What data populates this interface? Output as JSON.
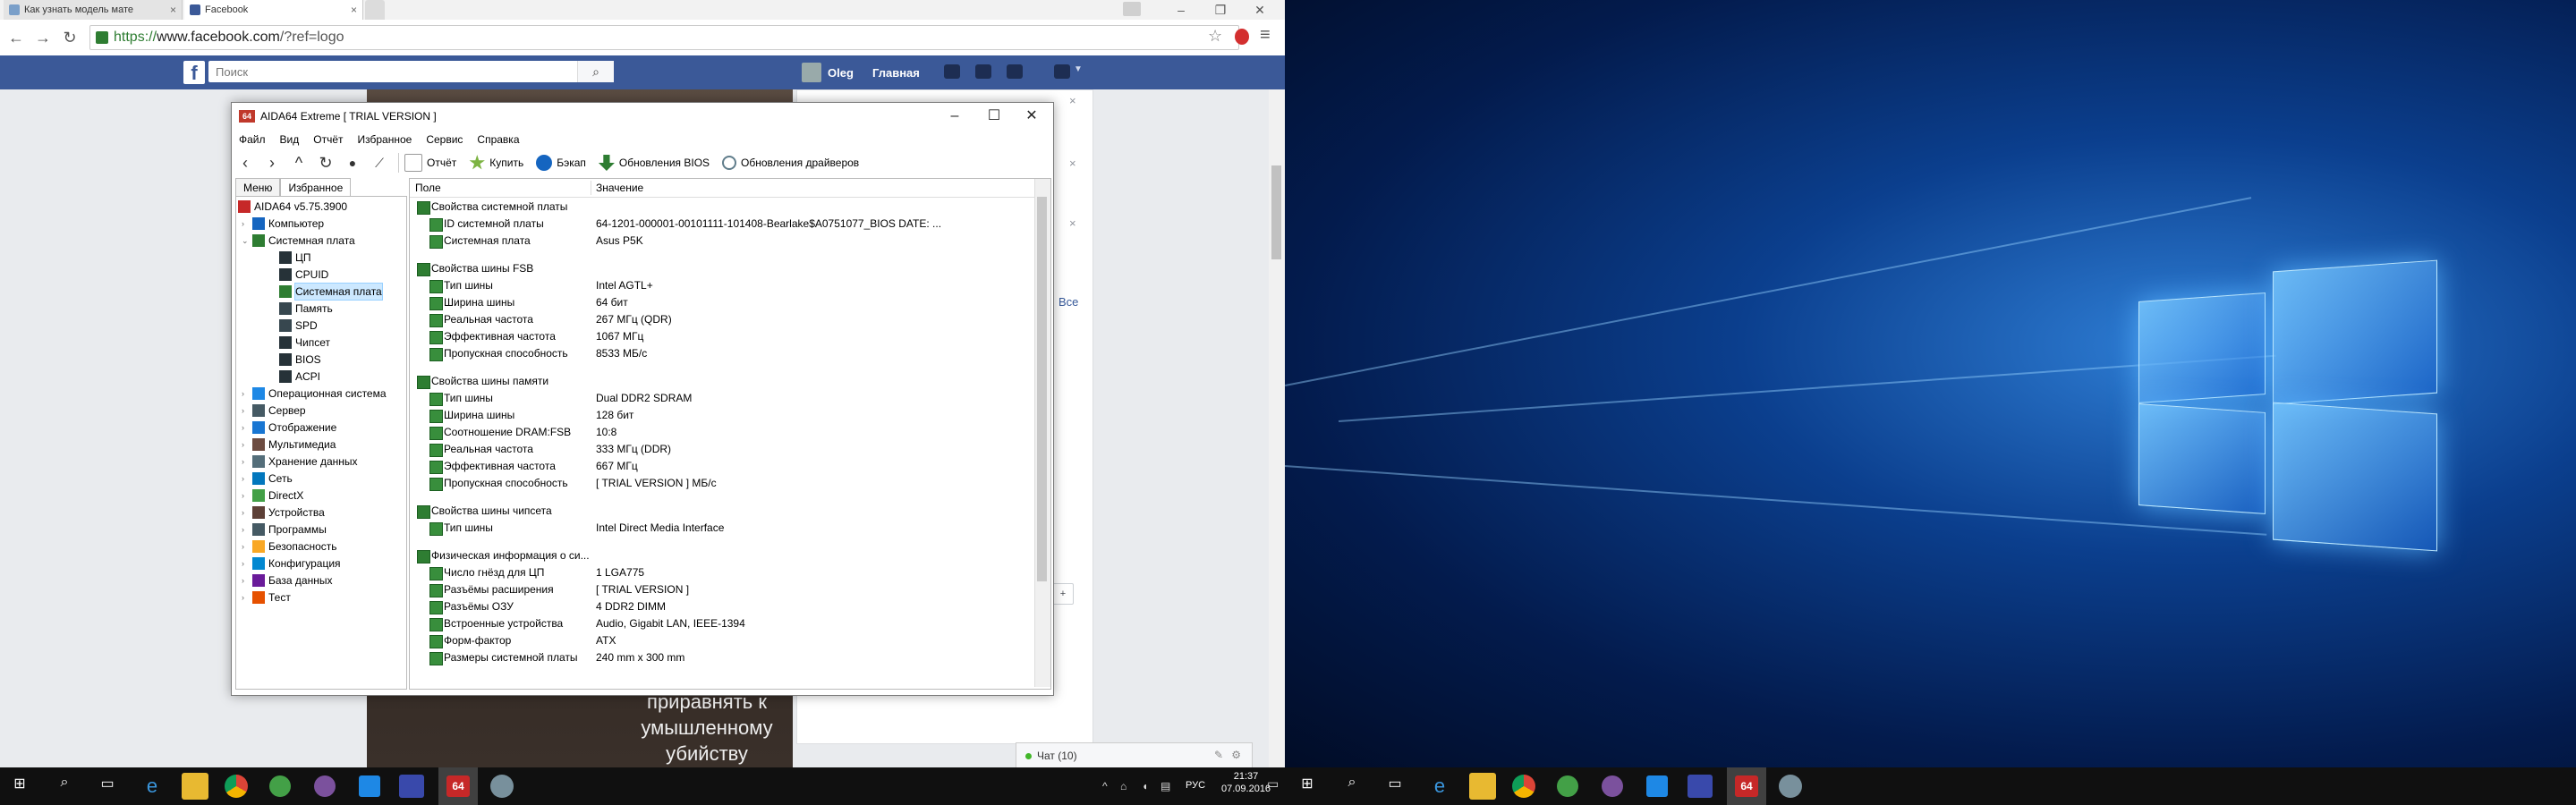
{
  "browser": {
    "tabs": [
      {
        "title": "Как узнать модель мате",
        "active": false
      },
      {
        "title": "Facebook",
        "active": true
      }
    ],
    "url_scheme": "https://",
    "url_host": "www.facebook.com",
    "url_path": "/?ref=logo"
  },
  "facebook": {
    "logo": "f",
    "search_placeholder": "Поиск",
    "user_name": "Oleg",
    "home_label": "Главная",
    "all_link": "Все",
    "promo_text": "приравнять к умышленному убийству",
    "chat_label": "Чат (10)",
    "brand_color": "#3b5998"
  },
  "aida": {
    "title": "AIDA64 Extreme  [ TRIAL VERSION ]",
    "icon_text": "64",
    "menu": [
      "Файл",
      "Вид",
      "Отчёт",
      "Избранное",
      "Сервис",
      "Справка"
    ],
    "toolbar_actions": [
      "Отчёт",
      "Купить",
      "Бэкап",
      "Обновления BIOS",
      "Обновления драйверов"
    ],
    "left_tabs": [
      "Меню",
      "Избранное"
    ],
    "tree": [
      {
        "label": "AIDA64 v5.75.3900",
        "level": 0,
        "arrow": "",
        "icon": "aida"
      },
      {
        "label": "Компьютер",
        "level": 1,
        "arrow": "›",
        "icon": "computer"
      },
      {
        "label": "Системная плата",
        "level": 1,
        "arrow": "⌄",
        "icon": "board"
      },
      {
        "label": "ЦП",
        "level": 2,
        "arrow": "",
        "icon": "chip"
      },
      {
        "label": "CPUID",
        "level": 2,
        "arrow": "",
        "icon": "chip"
      },
      {
        "label": "Системная плата",
        "level": 2,
        "arrow": "",
        "icon": "board",
        "selected": true
      },
      {
        "label": "Память",
        "level": 2,
        "arrow": "",
        "icon": "memory"
      },
      {
        "label": "SPD",
        "level": 2,
        "arrow": "",
        "icon": "memory"
      },
      {
        "label": "Чипсет",
        "level": 2,
        "arrow": "",
        "icon": "chip"
      },
      {
        "label": "BIOS",
        "level": 2,
        "arrow": "",
        "icon": "chip"
      },
      {
        "label": "ACPI",
        "level": 2,
        "arrow": "",
        "icon": "chip"
      },
      {
        "label": "Операционная система",
        "level": 1,
        "arrow": "›",
        "icon": "windows"
      },
      {
        "label": "Сервер",
        "level": 1,
        "arrow": "›",
        "icon": "server"
      },
      {
        "label": "Отображение",
        "level": 1,
        "arrow": "›",
        "icon": "display"
      },
      {
        "label": "Мультимедиа",
        "level": 1,
        "arrow": "›",
        "icon": "multimedia"
      },
      {
        "label": "Хранение данных",
        "level": 1,
        "arrow": "›",
        "icon": "storage"
      },
      {
        "label": "Сеть",
        "level": 1,
        "arrow": "›",
        "icon": "network"
      },
      {
        "label": "DirectX",
        "level": 1,
        "arrow": "›",
        "icon": "directx"
      },
      {
        "label": "Устройства",
        "level": 1,
        "arrow": "›",
        "icon": "devices"
      },
      {
        "label": "Программы",
        "level": 1,
        "arrow": "›",
        "icon": "programs"
      },
      {
        "label": "Безопасность",
        "level": 1,
        "arrow": "›",
        "icon": "security"
      },
      {
        "label": "Конфигурация",
        "level": 1,
        "arrow": "›",
        "icon": "config"
      },
      {
        "label": "База данных",
        "level": 1,
        "arrow": "›",
        "icon": "database"
      },
      {
        "label": "Тест",
        "level": 1,
        "arrow": "›",
        "icon": "test"
      }
    ],
    "table_head": {
      "field": "Поле",
      "value": "Значение"
    },
    "rows": [
      {
        "type": "group",
        "field": "Свойства системной платы",
        "value": ""
      },
      {
        "type": "child",
        "field": "ID системной платы",
        "value": "64-1201-000001-00101111-101408-Bearlake$A0751077_BIOS DATE: ..."
      },
      {
        "type": "child",
        "field": "Системная плата",
        "value": "Asus P5K"
      },
      {
        "type": "blank"
      },
      {
        "type": "group",
        "field": "Свойства шины FSB",
        "value": ""
      },
      {
        "type": "child",
        "field": "Тип шины",
        "value": "Intel AGTL+"
      },
      {
        "type": "child",
        "field": "Ширина шины",
        "value": "64 бит"
      },
      {
        "type": "child",
        "field": "Реальная частота",
        "value": "267 МГц (QDR)"
      },
      {
        "type": "child",
        "field": "Эффективная частота",
        "value": "1067 МГц"
      },
      {
        "type": "child",
        "field": "Пропускная способность",
        "value": "8533 МБ/с"
      },
      {
        "type": "blank"
      },
      {
        "type": "group",
        "field": "Свойства шины памяти",
        "value": ""
      },
      {
        "type": "child",
        "field": "Тип шины",
        "value": "Dual DDR2 SDRAM"
      },
      {
        "type": "child",
        "field": "Ширина шины",
        "value": "128 бит"
      },
      {
        "type": "child",
        "field": "Соотношение DRAM:FSB",
        "value": "10:8"
      },
      {
        "type": "child",
        "field": "Реальная частота",
        "value": "333 МГц (DDR)"
      },
      {
        "type": "child",
        "field": "Эффективная частота",
        "value": "667 МГц"
      },
      {
        "type": "child",
        "field": "Пропускная способность",
        "value": "[ TRIAL VERSION ] МБ/с"
      },
      {
        "type": "blank"
      },
      {
        "type": "group",
        "field": "Свойства шины чипсета",
        "value": ""
      },
      {
        "type": "child",
        "field": "Тип шины",
        "value": "Intel Direct Media Interface"
      },
      {
        "type": "blank"
      },
      {
        "type": "group",
        "field": "Физическая информация о си...",
        "value": ""
      },
      {
        "type": "child",
        "field": "Число гнёзд для ЦП",
        "value": "1 LGA775"
      },
      {
        "type": "child",
        "field": "Разъёмы расширения",
        "value": "[ TRIAL VERSION ]"
      },
      {
        "type": "child",
        "field": "Разъёмы ОЗУ",
        "value": "4 DDR2 DIMM"
      },
      {
        "type": "child",
        "field": "Встроенные устройства",
        "value": "Audio, Gigabit LAN, IEEE-1394"
      },
      {
        "type": "child",
        "field": "Форм-фактор",
        "value": "ATX"
      },
      {
        "type": "child",
        "field": "Размеры системной платы",
        "value": "240 mm x 300 mm"
      }
    ]
  },
  "taskbar": {
    "language": "РУС",
    "time": "21:37",
    "date": "07.09.2016"
  }
}
